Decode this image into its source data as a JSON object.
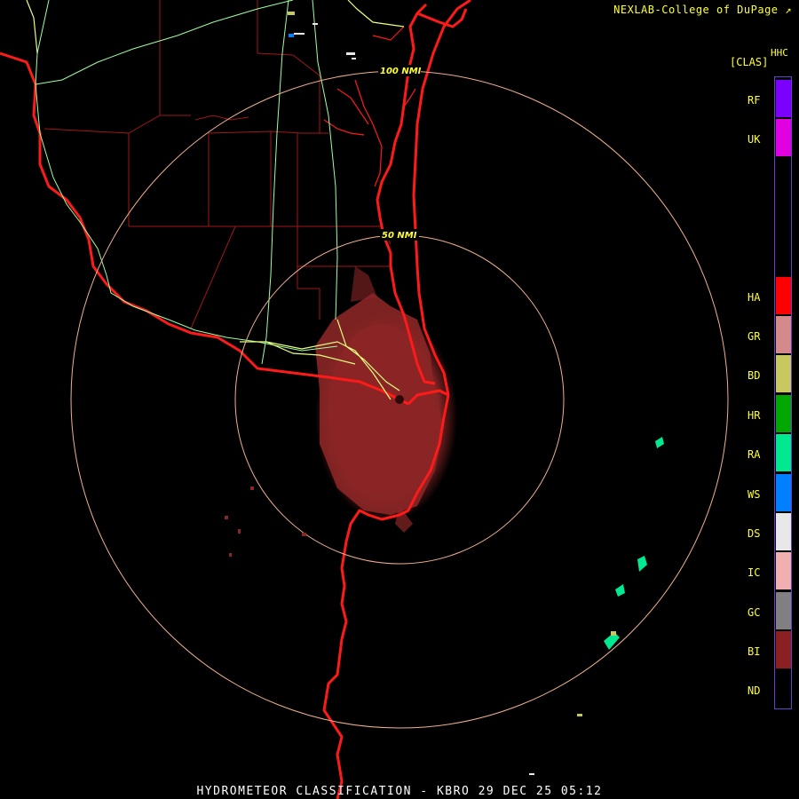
{
  "credit": "NEXLAB-College of DuPage",
  "product": {
    "code": "HHC",
    "abbr": "[CLAS]"
  },
  "footer": "HYDROMETEOR CLASSIFICATION - KBRO 29 DEC 25 05:12",
  "range_rings": [
    {
      "label": "50 NMI"
    },
    {
      "label": "100 NMI"
    }
  ],
  "legend": [
    {
      "code": "RF",
      "color": "#7b00ff"
    },
    {
      "code": "UK",
      "color": "#e000e0"
    },
    {
      "code": "HA",
      "color": "#ff0000"
    },
    {
      "code": "GR",
      "color": "#d48a8a"
    },
    {
      "code": "BD",
      "color": "#c8c860"
    },
    {
      "code": "HR",
      "color": "#00a800"
    },
    {
      "code": "RA",
      "color": "#00e890"
    },
    {
      "code": "WS",
      "color": "#0080ff"
    },
    {
      "code": "DS",
      "color": "#e8e8e8"
    },
    {
      "code": "IC",
      "color": "#f0b0b0"
    },
    {
      "code": "GC",
      "color": "#808080"
    },
    {
      "code": "BI",
      "color": "#8b2020"
    },
    {
      "code": "ND",
      "color": "#000000"
    }
  ],
  "colors": {
    "coast": "#ff1a1a",
    "county": "#a01818",
    "ring": "#f0b090",
    "highway": "#e8ff80",
    "secondary_road": "#a0ffa0"
  },
  "icon": "external-link-icon"
}
